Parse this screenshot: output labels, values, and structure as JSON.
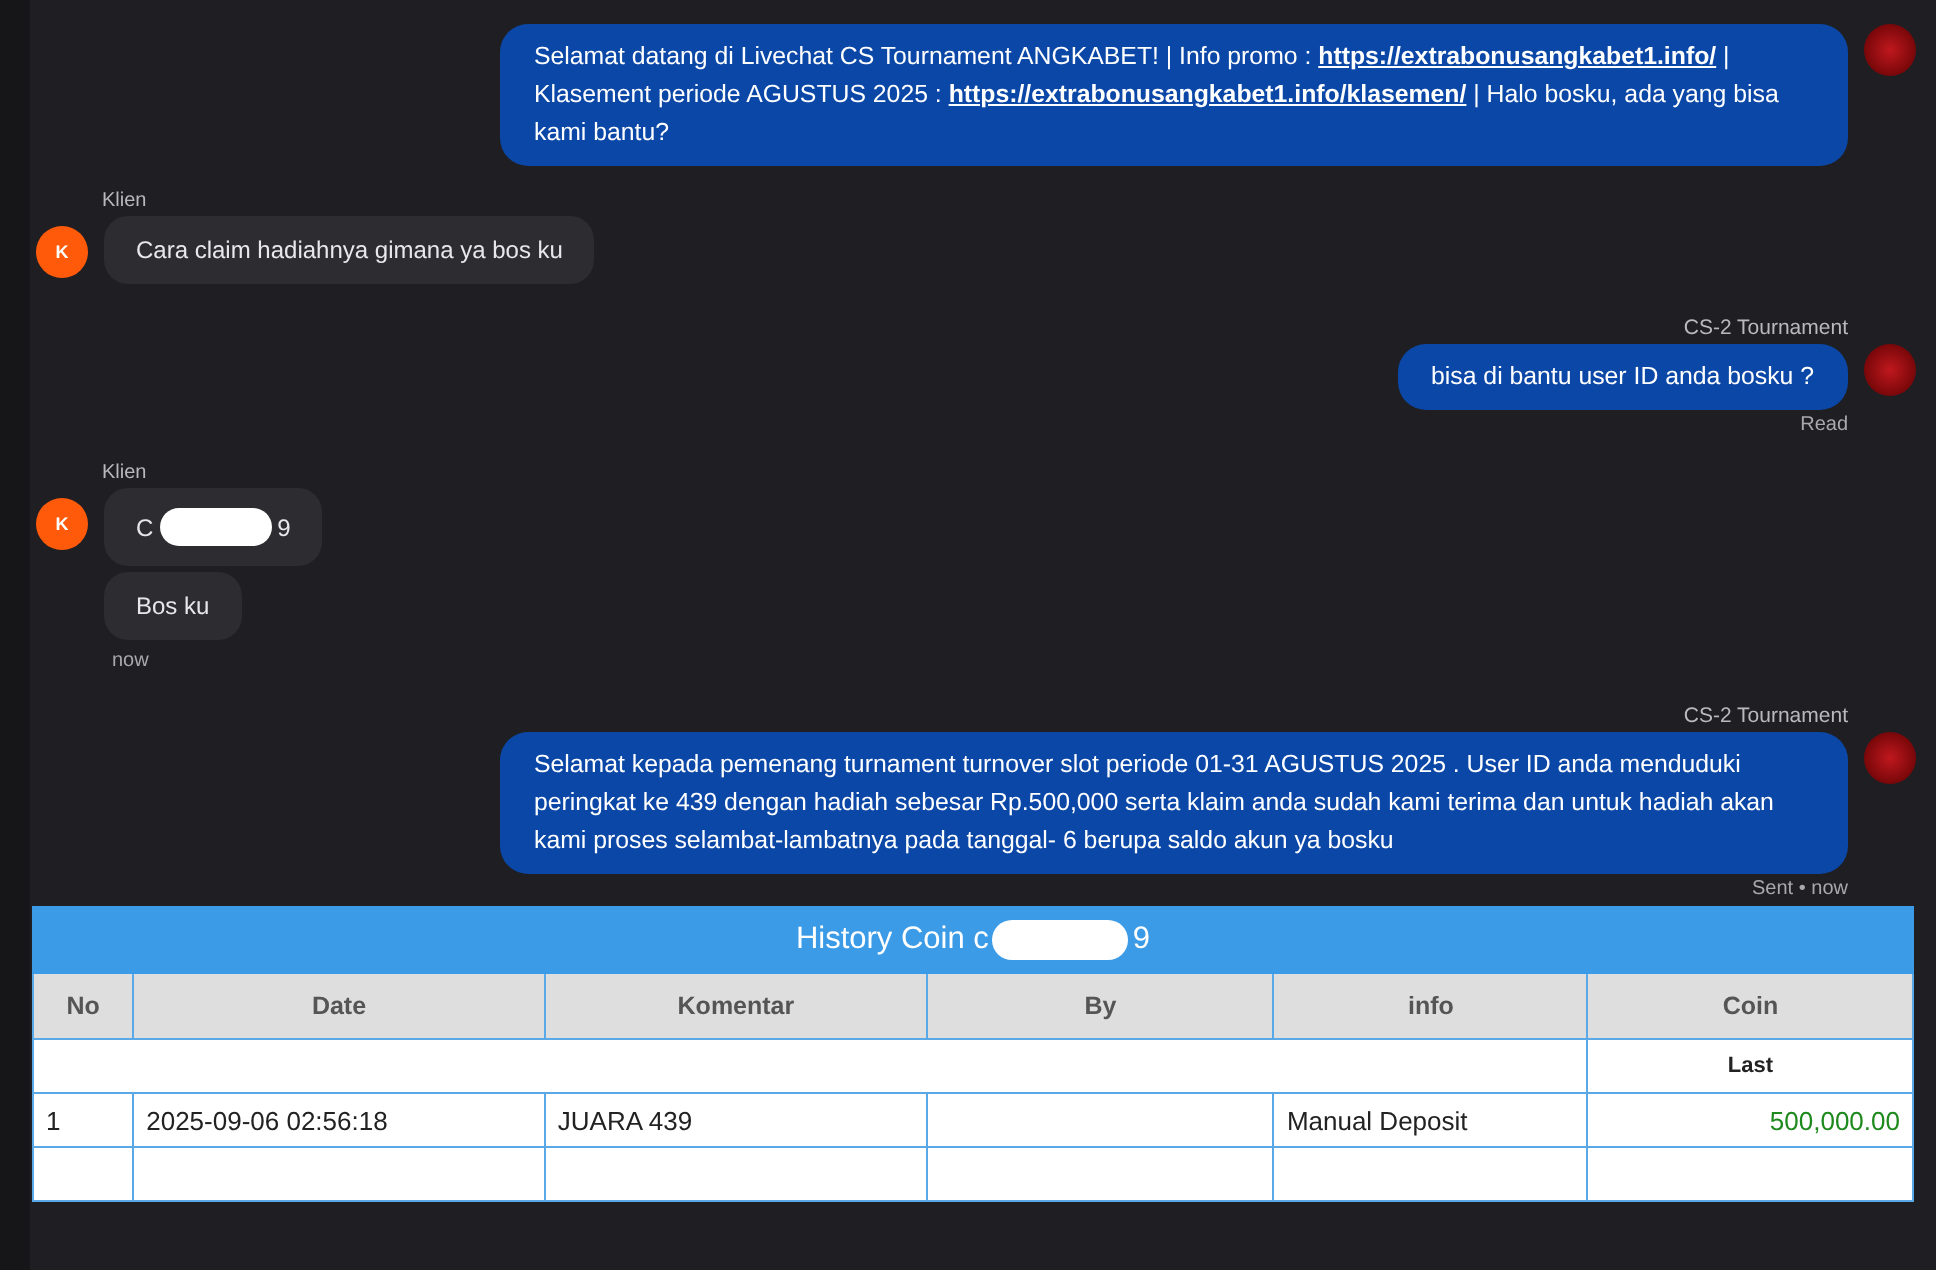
{
  "messages": [
    {
      "kind": "agent",
      "segments": [
        {
          "text": "Selamat datang di Livechat CS Tournament ANGKABET! | Info promo : ",
          "link": false
        },
        {
          "text": "https://extrabonusangkabet1.info/",
          "link": true
        },
        {
          "text": " | Klasement periode AGUSTUS 2025 : ",
          "link": false
        },
        {
          "text": "https://extrabonusangkabet1.info/klasemen/",
          "link": true
        },
        {
          "text": " | Halo bosku, ada yang bisa kami bantu?",
          "link": false
        }
      ]
    },
    {
      "kind": "client",
      "sender": "Klien",
      "avatar": "K",
      "bubbles": [
        {
          "text": "Cara claim hadiahnya gimana ya bos ku",
          "redacted": false
        }
      ]
    },
    {
      "kind": "agent",
      "sender": "CS-2 Tournament",
      "segments": [
        {
          "text": "bisa di bantu user ID anda bosku ?",
          "link": false
        }
      ],
      "status": "Read"
    },
    {
      "kind": "client",
      "sender": "Klien",
      "avatar": "K",
      "bubbles": [
        {
          "text": "C",
          "text_end": "9",
          "redacted": true
        },
        {
          "text": "Bos ku",
          "redacted": false
        }
      ],
      "time": "now"
    },
    {
      "kind": "agent",
      "sender": "CS-2 Tournament",
      "segments": [
        {
          "text": "Selamat kepada pemenang turnament turnover slot periode 01-31 AGUSTUS 2025 . User ID anda menduduki peringkat ke 439 dengan hadiah sebesar Rp.500,000 serta klaim anda sudah kami terima dan untuk hadiah akan kami proses selambat-lambatnya pada tanggal- 6 berupa saldo akun ya bosku",
          "link": false
        }
      ],
      "status": "Sent • now"
    }
  ],
  "history_table": {
    "title_start": "History Coin c",
    "title_end": "9",
    "columns": [
      "No",
      "Date",
      "Komentar",
      "By",
      "info",
      "Coin"
    ],
    "subheader": "Last",
    "rows": [
      {
        "no": "1",
        "date": "2025-09-06 02:56:18",
        "komentar": "JUARA 439",
        "by": "",
        "info": "Manual Deposit",
        "coin": "500,000.00"
      }
    ]
  }
}
